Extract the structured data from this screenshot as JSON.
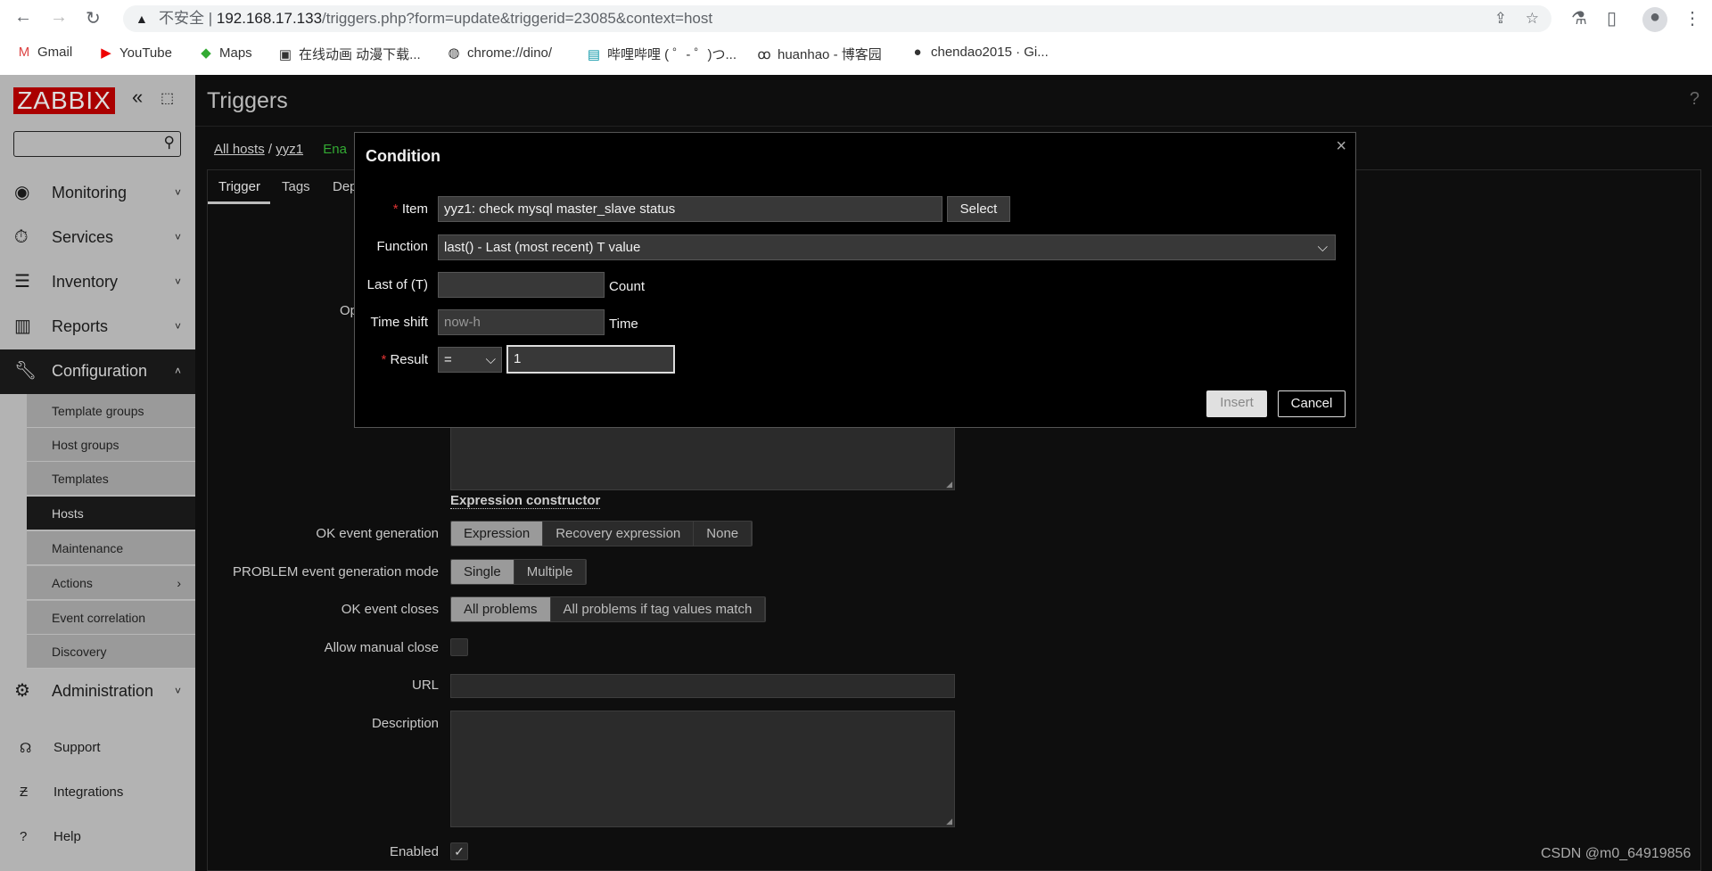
{
  "browser": {
    "security": "不安全",
    "url_host": "192.168.17.133",
    "url_path": "/triggers.php?form=update&triggerid=23085&context=host",
    "bookmarks": [
      "Gmail",
      "YouTube",
      "Maps",
      "在线动画 动漫下载...",
      "chrome://dino/",
      "哔哩哔哩 ( ゜- ゜)つ...",
      "huanhao - 博客园",
      "chendao2015 · Gi..."
    ]
  },
  "sidebar": {
    "logo": "ZABBIX",
    "menu": [
      {
        "label": "Monitoring",
        "icon": "eye-icon"
      },
      {
        "label": "Services",
        "icon": "stopwatch-icon"
      },
      {
        "label": "Inventory",
        "icon": "list-icon"
      },
      {
        "label": "Reports",
        "icon": "bar-chart-icon"
      },
      {
        "label": "Configuration",
        "icon": "wrench-icon"
      }
    ],
    "submenu": [
      "Template groups",
      "Host groups",
      "Templates",
      "Hosts",
      "Maintenance",
      "Actions",
      "Event correlation",
      "Discovery"
    ],
    "admin": "Administration",
    "bottom": [
      "Support",
      "Integrations",
      "Help"
    ]
  },
  "page": {
    "title": "Triggers",
    "help": "?",
    "breadcrumb": {
      "all_hosts": "All hosts",
      "host": "yyz1",
      "status": "Ena"
    },
    "tabs": [
      "Trigger",
      "Tags",
      "Dep"
    ],
    "op_label": "Op",
    "expression_constructor": "Expression constructor",
    "ok_event_generation": {
      "label": "OK event generation",
      "options": [
        "Expression",
        "Recovery expression",
        "None"
      ],
      "selected": "Expression"
    },
    "problem_mode": {
      "label": "PROBLEM event generation mode",
      "options": [
        "Single",
        "Multiple"
      ],
      "selected": "Single"
    },
    "ok_event_closes": {
      "label": "OK event closes",
      "options": [
        "All problems",
        "All problems if tag values match"
      ],
      "selected": "All problems"
    },
    "allow_manual_close": {
      "label": "Allow manual close",
      "checked": false
    },
    "url": {
      "label": "URL",
      "value": ""
    },
    "description": {
      "label": "Description",
      "value": ""
    },
    "enabled": {
      "label": "Enabled",
      "checked": true
    }
  },
  "dialog": {
    "title": "Condition",
    "close": "×",
    "item": {
      "label": "Item",
      "value": "yyz1: check mysql master_slave status",
      "button": "Select"
    },
    "function": {
      "label": "Function",
      "value": "last() - Last (most recent) T value"
    },
    "last_of": {
      "label": "Last of (T)",
      "value": "",
      "suffix": "Count"
    },
    "time_shift": {
      "label": "Time shift",
      "placeholder": "now-h",
      "suffix": "Time"
    },
    "result": {
      "label": "Result",
      "operator": "=",
      "value": "1"
    },
    "insert": "Insert",
    "cancel": "Cancel"
  },
  "watermark": "CSDN @m0_64919856"
}
